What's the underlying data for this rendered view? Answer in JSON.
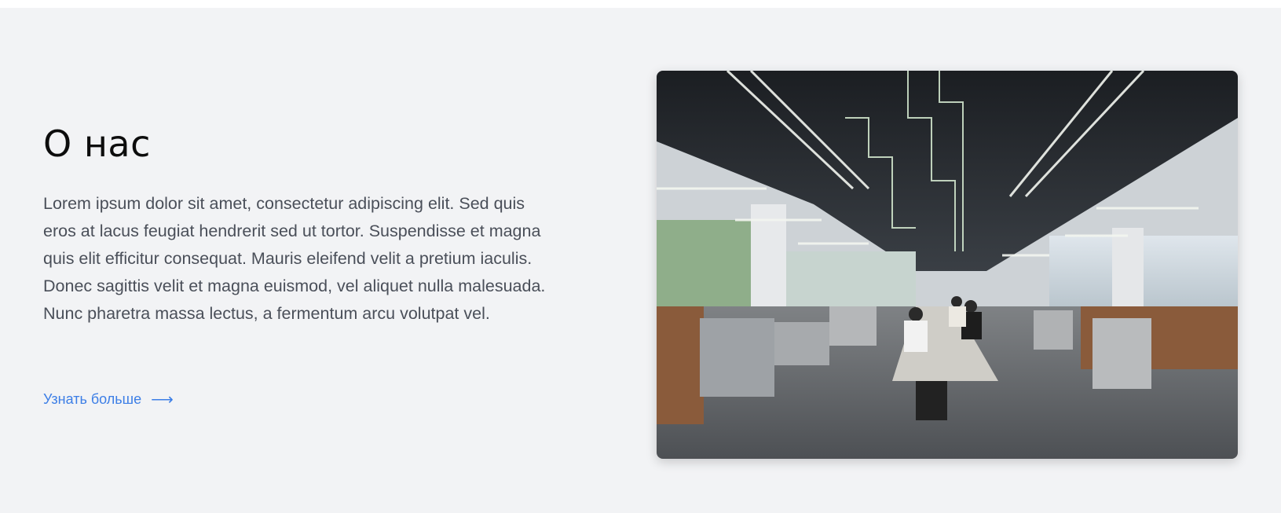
{
  "about": {
    "title": "О нас",
    "paragraph": "Lorem ipsum dolor sit amet, consectetur adipiscing elit. Sed quis eros at lacus feugiat hendrerit sed ut tortor. Suspendisse et magna quis elit efficitur consequat. Mauris eleifend velit a pretium iaculis. Donec sagittis velit et magna euismod, vel aliquet nulla malesuada. Nunc pharetra massa lectus, a fermentum arcu volutpat vel.",
    "cta_label": "Узнать больше",
    "cta_icon": "arrow-right-icon",
    "accent_color": "#3c7ee6",
    "background_color": "#f2f3f5",
    "image_subject": "office-interior-photo"
  }
}
